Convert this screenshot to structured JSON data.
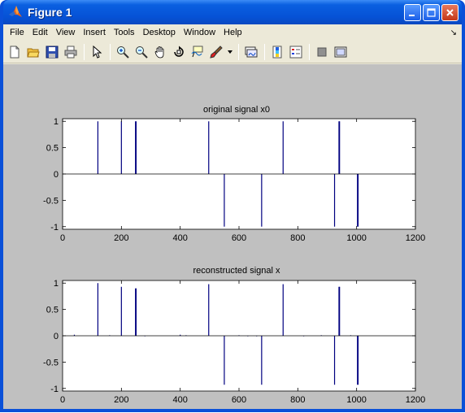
{
  "window": {
    "title": "Figure 1"
  },
  "menu": {
    "items": [
      "File",
      "Edit",
      "View",
      "Insert",
      "Tools",
      "Desktop",
      "Window",
      "Help"
    ]
  },
  "toolbar": {
    "icons": [
      "new-figure-icon",
      "open-file-icon",
      "save-icon",
      "print-icon",
      "edit-plot-arrow-icon",
      "zoom-in-icon",
      "zoom-out-icon",
      "pan-hand-icon",
      "rotate-3d-icon",
      "data-cursor-icon",
      "brush-icon",
      "brush-dropdown-icon",
      "link-plot-icon",
      "insert-colorbar-icon",
      "insert-legend-icon",
      "hide-plot-tools-icon",
      "show-plot-tools-icon"
    ]
  },
  "colors": {
    "stem": "#000080",
    "baseline": "#000000",
    "figure_bg": "#c0c0c0",
    "axes_bg": "#ffffff"
  },
  "chart_data": [
    {
      "type": "stem",
      "title": "original signal x0",
      "xlabel": "",
      "ylabel": "",
      "xlim": [
        0,
        1200
      ],
      "ylim": [
        -1.05,
        1.05
      ],
      "xticks": [
        "0",
        "200",
        "400",
        "600",
        "800",
        "1000",
        "1200"
      ],
      "yticks": [
        "-1",
        "-0.5",
        "0",
        "0.5",
        "1"
      ],
      "grid": false,
      "points": [
        {
          "x": 120,
          "y": 1.0
        },
        {
          "x": 200,
          "y": 1.0
        },
        {
          "x": 248,
          "y": 1.0
        },
        {
          "x": 250,
          "y": 1.0
        },
        {
          "x": 497,
          "y": 1.0
        },
        {
          "x": 550,
          "y": -1.0
        },
        {
          "x": 677,
          "y": -1.0
        },
        {
          "x": 750,
          "y": 1.0
        },
        {
          "x": 925,
          "y": -1.0
        },
        {
          "x": 940,
          "y": 1.0
        },
        {
          "x": 942,
          "y": 1.0
        },
        {
          "x": 1003,
          "y": -1.0
        },
        {
          "x": 1005,
          "y": -1.0
        }
      ]
    },
    {
      "type": "stem",
      "title": "reconstructed signal x",
      "xlabel": "",
      "ylabel": "",
      "xlim": [
        0,
        1200
      ],
      "ylim": [
        -1.05,
        1.05
      ],
      "xticks": [
        "0",
        "200",
        "400",
        "600",
        "800",
        "1000",
        "1200"
      ],
      "yticks": [
        "-1",
        "-0.5",
        "0",
        "0.5",
        "1"
      ],
      "grid": false,
      "points": [
        {
          "x": 40,
          "y": 0.02
        },
        {
          "x": 120,
          "y": 1.0
        },
        {
          "x": 160,
          "y": 0.01
        },
        {
          "x": 200,
          "y": 0.93
        },
        {
          "x": 248,
          "y": 0.9
        },
        {
          "x": 250,
          "y": 0.9
        },
        {
          "x": 280,
          "y": -0.01
        },
        {
          "x": 400,
          "y": 0.02
        },
        {
          "x": 420,
          "y": 0.01
        },
        {
          "x": 497,
          "y": 0.98
        },
        {
          "x": 550,
          "y": -0.93
        },
        {
          "x": 600,
          "y": 0.01
        },
        {
          "x": 630,
          "y": -0.01
        },
        {
          "x": 660,
          "y": -0.01
        },
        {
          "x": 677,
          "y": -0.93
        },
        {
          "x": 750,
          "y": 0.98
        },
        {
          "x": 820,
          "y": -0.01
        },
        {
          "x": 880,
          "y": 0.01
        },
        {
          "x": 925,
          "y": -0.93
        },
        {
          "x": 940,
          "y": 0.93
        },
        {
          "x": 942,
          "y": 0.93
        },
        {
          "x": 980,
          "y": 0.01
        },
        {
          "x": 1003,
          "y": -0.93
        },
        {
          "x": 1005,
          "y": -0.93
        }
      ]
    }
  ]
}
